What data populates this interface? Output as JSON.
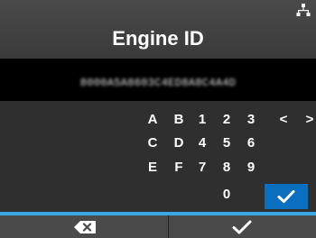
{
  "header": {
    "title": "Engine ID",
    "status_icon": "network-icon"
  },
  "value": {
    "text": "8000A5A8603C4ED8A8C4A4D"
  },
  "keypad": {
    "rows": [
      [
        "A",
        "B",
        "1",
        "2",
        "3",
        "<",
        ">"
      ],
      [
        "C",
        "D",
        "4",
        "5",
        "6"
      ],
      [
        "E",
        "F",
        "7",
        "8",
        "9"
      ],
      [
        "0"
      ]
    ],
    "ok_icon": "checkmark-icon",
    "accent": "#0a6fbf"
  },
  "bottom": {
    "left_icon": "backspace-icon",
    "right_icon": "checkmark-icon"
  }
}
